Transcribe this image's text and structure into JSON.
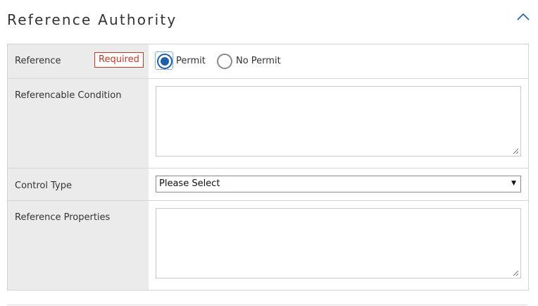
{
  "section": {
    "title": "Reference Authority",
    "collapse_icon": "chevron-up-icon",
    "accent_color": "#1f5fa8"
  },
  "fields": {
    "reference": {
      "label": "Reference",
      "required_badge": "Required",
      "required_color": "#c0392b",
      "options": [
        {
          "label": "Permit",
          "checked": true
        },
        {
          "label": "No Permit",
          "checked": false
        }
      ]
    },
    "referencable_condition": {
      "label": "Referencable Condition",
      "value": ""
    },
    "control_type": {
      "label": "Control Type",
      "selected": "Please Select"
    },
    "reference_properties": {
      "label": "Reference Properties",
      "value": ""
    }
  }
}
